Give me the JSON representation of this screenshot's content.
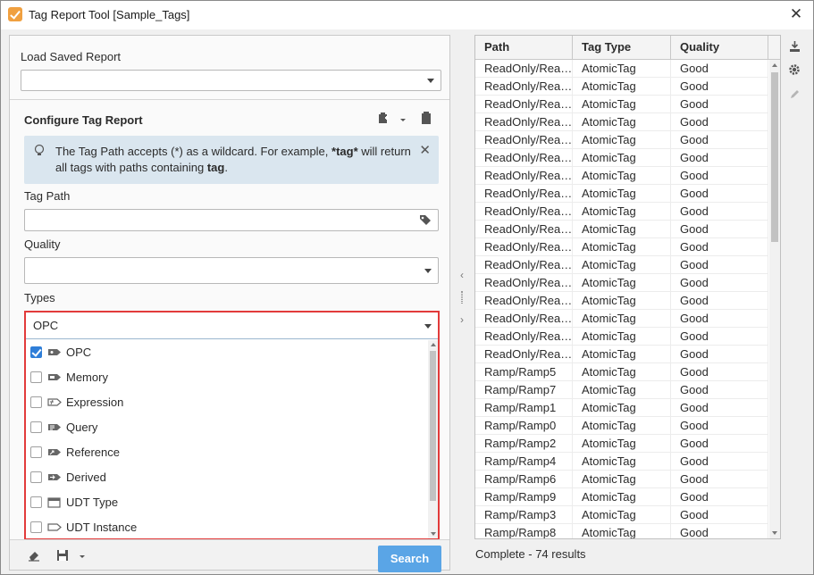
{
  "window": {
    "title": "Tag Report Tool [Sample_Tags]"
  },
  "load": {
    "label": "Load Saved Report",
    "value": ""
  },
  "configure": {
    "title": "Configure Tag Report",
    "info_part1": "The Tag Path accepts (*) as a wildcard. For example, ",
    "info_bold1": "*tag*",
    "info_part2": " will return all tags with paths containing ",
    "info_bold2": "tag",
    "info_part3": ".",
    "tag_path_label": "Tag Path",
    "tag_path_value": "",
    "quality_label": "Quality",
    "quality_value": "",
    "types_label": "Types",
    "types_value": "OPC",
    "types": [
      {
        "label": "OPC",
        "checked": true,
        "icon": "opc-tag-icon"
      },
      {
        "label": "Memory",
        "checked": false,
        "icon": "memory-tag-icon"
      },
      {
        "label": "Expression",
        "checked": false,
        "icon": "expression-tag-icon"
      },
      {
        "label": "Query",
        "checked": false,
        "icon": "query-tag-icon"
      },
      {
        "label": "Reference",
        "checked": false,
        "icon": "reference-tag-icon"
      },
      {
        "label": "Derived",
        "checked": false,
        "icon": "derived-tag-icon"
      },
      {
        "label": "UDT Type",
        "checked": false,
        "icon": "udt-type-icon"
      },
      {
        "label": "UDT Instance",
        "checked": false,
        "icon": "udt-instance-icon"
      }
    ]
  },
  "footer": {
    "search_label": "Search"
  },
  "table": {
    "columns": [
      "Path",
      "Tag Type",
      "Quality"
    ],
    "rows": [
      [
        "ReadOnly/Rea…",
        "AtomicTag",
        "Good"
      ],
      [
        "ReadOnly/Rea…",
        "AtomicTag",
        "Good"
      ],
      [
        "ReadOnly/Rea…",
        "AtomicTag",
        "Good"
      ],
      [
        "ReadOnly/Rea…",
        "AtomicTag",
        "Good"
      ],
      [
        "ReadOnly/Rea…",
        "AtomicTag",
        "Good"
      ],
      [
        "ReadOnly/Rea…",
        "AtomicTag",
        "Good"
      ],
      [
        "ReadOnly/Rea…",
        "AtomicTag",
        "Good"
      ],
      [
        "ReadOnly/Rea…",
        "AtomicTag",
        "Good"
      ],
      [
        "ReadOnly/Rea…",
        "AtomicTag",
        "Good"
      ],
      [
        "ReadOnly/Rea…",
        "AtomicTag",
        "Good"
      ],
      [
        "ReadOnly/Rea…",
        "AtomicTag",
        "Good"
      ],
      [
        "ReadOnly/Rea…",
        "AtomicTag",
        "Good"
      ],
      [
        "ReadOnly/Rea…",
        "AtomicTag",
        "Good"
      ],
      [
        "ReadOnly/Rea…",
        "AtomicTag",
        "Good"
      ],
      [
        "ReadOnly/Rea…",
        "AtomicTag",
        "Good"
      ],
      [
        "ReadOnly/Rea…",
        "AtomicTag",
        "Good"
      ],
      [
        "ReadOnly/Rea…",
        "AtomicTag",
        "Good"
      ],
      [
        "Ramp/Ramp5",
        "AtomicTag",
        "Good"
      ],
      [
        "Ramp/Ramp7",
        "AtomicTag",
        "Good"
      ],
      [
        "Ramp/Ramp1",
        "AtomicTag",
        "Good"
      ],
      [
        "Ramp/Ramp0",
        "AtomicTag",
        "Good"
      ],
      [
        "Ramp/Ramp2",
        "AtomicTag",
        "Good"
      ],
      [
        "Ramp/Ramp4",
        "AtomicTag",
        "Good"
      ],
      [
        "Ramp/Ramp6",
        "AtomicTag",
        "Good"
      ],
      [
        "Ramp/Ramp9",
        "AtomicTag",
        "Good"
      ],
      [
        "Ramp/Ramp3",
        "AtomicTag",
        "Good"
      ],
      [
        "Ramp/Ramp8",
        "AtomicTag",
        "Good"
      ]
    ]
  },
  "status": "Complete - 74 results",
  "colors": {
    "accent": "#2f7ed8",
    "search": "#5aa5e6",
    "highlight": "#e23b3b",
    "info_bg": "#dae6ef"
  }
}
